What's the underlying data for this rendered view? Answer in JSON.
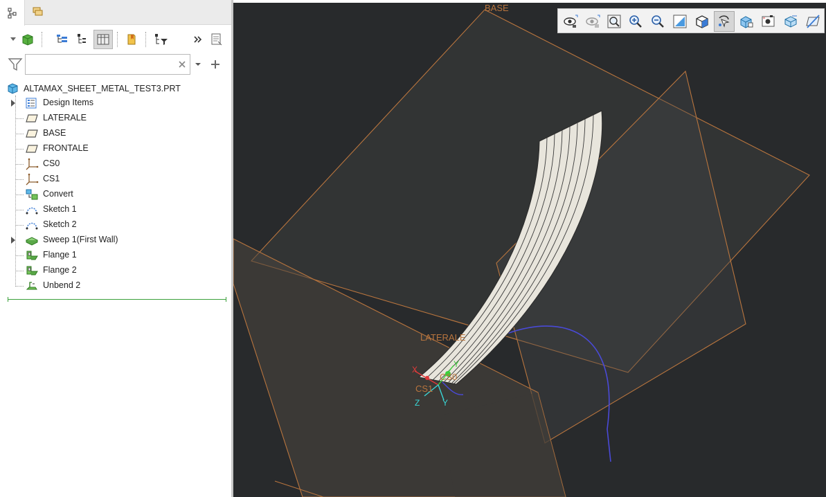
{
  "model_tree": {
    "root_label": "ALTAMAX_SHEET_METAL_TEST3.PRT",
    "items": [
      {
        "label": "Design Items",
        "icon": "design-items-icon",
        "expandable": true
      },
      {
        "label": "LATERALE",
        "icon": "datum-plane-icon",
        "expandable": false
      },
      {
        "label": "BASE",
        "icon": "datum-plane-icon",
        "expandable": false
      },
      {
        "label": "FRONTALE",
        "icon": "datum-plane-icon",
        "expandable": false
      },
      {
        "label": "CS0",
        "icon": "coordinate-system-icon",
        "expandable": false
      },
      {
        "label": "CS1",
        "icon": "coordinate-system-icon",
        "expandable": false
      },
      {
        "label": "Convert",
        "icon": "convert-icon",
        "expandable": false
      },
      {
        "label": "Sketch 1",
        "icon": "sketch-icon",
        "expandable": false
      },
      {
        "label": "Sketch 2",
        "icon": "sketch-icon",
        "expandable": false
      },
      {
        "label": "Sweep 1(First Wall)",
        "icon": "sweep-wall-icon",
        "expandable": true
      },
      {
        "label": "Flange 1",
        "icon": "flange-icon",
        "expandable": false
      },
      {
        "label": "Flange 2",
        "icon": "flange-icon",
        "expandable": false
      },
      {
        "label": "Unbend 2",
        "icon": "unbend-icon",
        "expandable": false
      }
    ]
  },
  "search": {
    "value": "",
    "placeholder": ""
  },
  "viewport": {
    "plane_labels": {
      "base": "BASE",
      "laterale": "LATERALE"
    },
    "csys_labels": {
      "cs0": "CS0",
      "cs1": "CS1",
      "x": "X",
      "y": "Y",
      "z": "Z"
    },
    "toolbar_icons": [
      "named-views-icon",
      "saved-orientations-icon",
      "refit-icon",
      "zoom-in-icon",
      "zoom-out-icon",
      "repaint-icon",
      "view-orientation-icon",
      "spin-center-icon",
      "display-style-icon",
      "perspective-view-icon",
      "section-view-icon",
      "datum-display-icon"
    ]
  },
  "colors": {
    "viewport_bg": "#282a2c",
    "datum_plane": "#b9753e",
    "part_surface": "#e8e5dc",
    "sketch_curve": "#4a4ad8",
    "insert_marker": "#3aa03a"
  }
}
